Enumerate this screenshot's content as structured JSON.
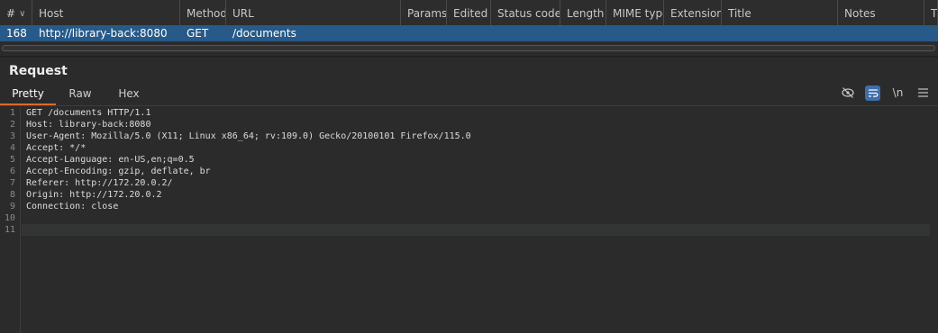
{
  "table": {
    "columns": [
      {
        "label": "#",
        "sort": "∨"
      },
      {
        "label": "Host"
      },
      {
        "label": "Method"
      },
      {
        "label": "URL"
      },
      {
        "label": "Params"
      },
      {
        "label": "Edited"
      },
      {
        "label": "Status code"
      },
      {
        "label": "Length"
      },
      {
        "label": "MIME type"
      },
      {
        "label": "Extension"
      },
      {
        "label": "Title"
      },
      {
        "label": "Notes"
      },
      {
        "label": "TI"
      }
    ],
    "selected_row": {
      "num": "168",
      "host": "http://library-back:8080",
      "method": "GET",
      "url": "/documents"
    }
  },
  "request": {
    "title": "Request",
    "tabs": [
      "Pretty",
      "Raw",
      "Hex"
    ],
    "toolbar": {
      "hide_icon": "eye-off-icon",
      "wrap_icon": "wrap-icon",
      "newline_label": "\\n",
      "menu_icon": "hamburger-icon"
    },
    "lines": [
      {
        "n": "1",
        "text": "GET /documents HTTP/1.1"
      },
      {
        "n": "2",
        "text": "Host: library-back:8080"
      },
      {
        "n": "3",
        "text": "User-Agent: Mozilla/5.0 (X11; Linux x86_64; rv:109.0) Gecko/20100101 Firefox/115.0"
      },
      {
        "n": "4",
        "text": "Accept: */*"
      },
      {
        "n": "5",
        "text": "Accept-Language: en-US,en;q=0.5"
      },
      {
        "n": "6",
        "text": "Accept-Encoding: gzip, deflate, br"
      },
      {
        "n": "7",
        "text": "Referer: http://172.20.0.2/"
      },
      {
        "n": "8",
        "text": "Origin: http://172.20.0.2"
      },
      {
        "n": "9",
        "text": "Connection: close"
      },
      {
        "n": "10",
        "text": ""
      },
      {
        "n": "11",
        "text": ""
      }
    ]
  }
}
